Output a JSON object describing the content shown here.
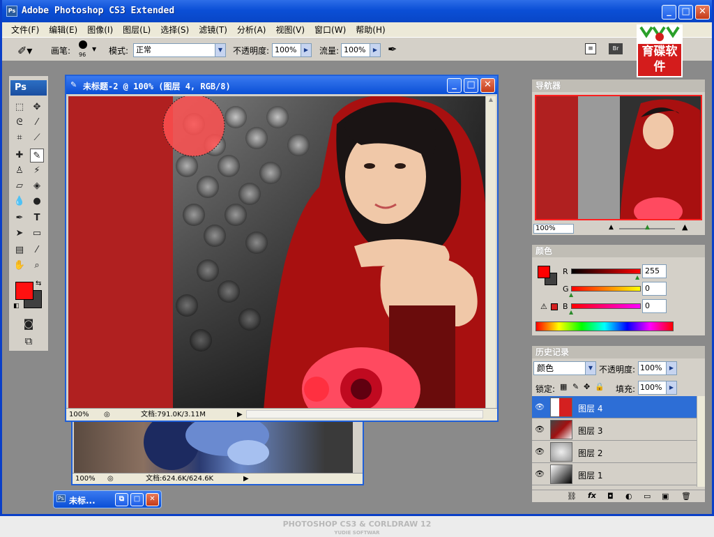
{
  "window": {
    "title": "Adobe Photoshop CS3 Extended",
    "app_icon_text": "Ps"
  },
  "menu": [
    "文件(F)",
    "编辑(E)",
    "图像(I)",
    "图层(L)",
    "选择(S)",
    "滤镜(T)",
    "分析(A)",
    "视图(V)",
    "窗口(W)",
    "帮助(H)"
  ],
  "options": {
    "brush_label": "画笔:",
    "brush_size": "96",
    "mode_label": "模式:",
    "mode_value": "正常",
    "opacity_label": "不透明度:",
    "opacity_value": "100%",
    "flow_label": "流量:",
    "flow_value": "100%"
  },
  "logo": {
    "text": "育碟软件"
  },
  "toolbox": {
    "badge": "Ps"
  },
  "doc_main": {
    "title": "未标题-2 @ 100% (图层 4, RGB/8)",
    "zoom": "100%",
    "doc_info": "文档:791.0K/3.11M"
  },
  "doc_back": {
    "zoom": "100%",
    "doc_info": "文档:624.6K/624.6K"
  },
  "doc_min": {
    "title": "未标..."
  },
  "navigator": {
    "title": "导航器",
    "zoom": "100%"
  },
  "color_panel": {
    "title": "颜色",
    "channels": [
      {
        "label": "R",
        "value": "255"
      },
      {
        "label": "G",
        "value": "0"
      },
      {
        "label": "B",
        "value": "0"
      }
    ],
    "foreground": "#ff0000",
    "background": "#404040"
  },
  "history_panel": {
    "title": "历史记录"
  },
  "layers_panel": {
    "blend_mode": "颜色",
    "opacity_label": "不透明度:",
    "opacity_value": "100%",
    "lock_label": "锁定:",
    "fill_label": "填充:",
    "fill_value": "100%",
    "layers": [
      {
        "name": "图层 4",
        "selected": true
      },
      {
        "name": "图层 3",
        "selected": false
      },
      {
        "name": "图层 2",
        "selected": false
      },
      {
        "name": "图层 1",
        "selected": false
      }
    ]
  },
  "footer": {
    "line1": "PHOTOSHOP CS3 & CORLDRAW 12",
    "line2": "YUDIE SOFTWAR"
  }
}
